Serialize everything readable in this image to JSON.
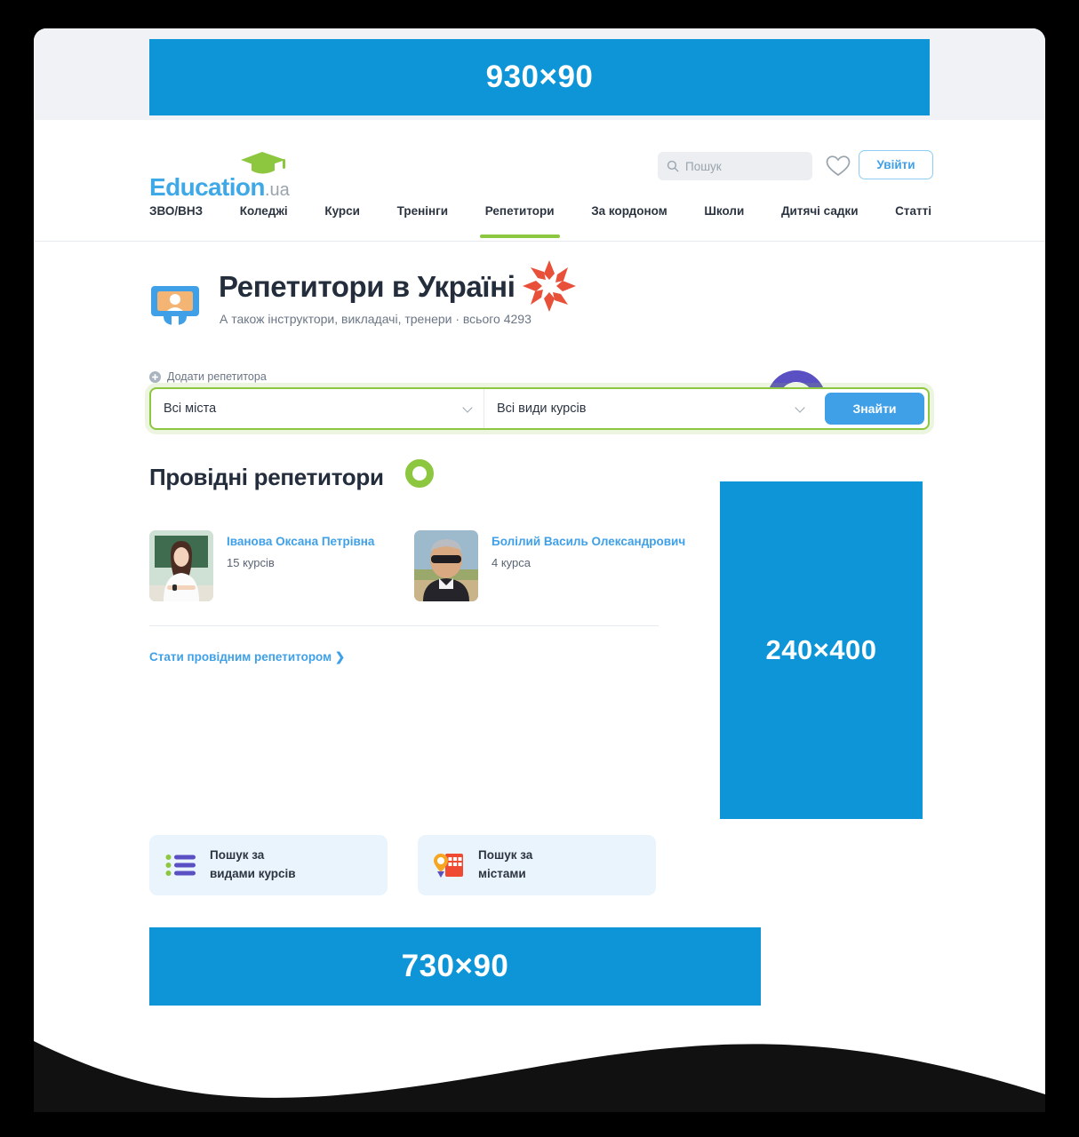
{
  "ads": {
    "top": {
      "label": "930×90"
    },
    "side": {
      "label": "240×400"
    },
    "bottom": {
      "label": "730×90"
    },
    "color": "#0d95d8"
  },
  "header": {
    "logo": {
      "name": "Education",
      "suffix": ".ua"
    },
    "search": {
      "placeholder": "Пошук",
      "value": ""
    },
    "login_label": "Увійти"
  },
  "nav": {
    "items": [
      {
        "label": "ЗВО/ВНЗ",
        "active": false
      },
      {
        "label": "Коледжі",
        "active": false
      },
      {
        "label": "Курси",
        "active": false
      },
      {
        "label": "Тренінги",
        "active": false
      },
      {
        "label": "Репетитори",
        "active": true
      },
      {
        "label": "За кордоном",
        "active": false
      },
      {
        "label": "Школи",
        "active": false
      },
      {
        "label": "Дитячі садки",
        "active": false
      },
      {
        "label": "Статті",
        "active": false
      }
    ],
    "active_color": "#8dc63f"
  },
  "page": {
    "title": "Репетитори в Україні",
    "subtitle": "А також інструктори, викладачі, тренери · всього 4293",
    "add_link": "Додати репетитора"
  },
  "filter": {
    "city": {
      "value": "Всі міста"
    },
    "kind": {
      "value": "Всі види курсів"
    },
    "submit_label": "Знайти",
    "accent": "#8dc63f",
    "button_color": "#3fa0e8"
  },
  "leading": {
    "section_title": "Провідні репетитори",
    "tutors": [
      {
        "name": "Іванова Оксана Петрівна",
        "courses": "15 курсів"
      },
      {
        "name": "Болілий Василь Олександрович",
        "courses": "4 курса"
      }
    ],
    "become_link": "Стати провідним репетитором ❯"
  },
  "cards": [
    {
      "line1": "Пошук за",
      "line2": "видами курсів",
      "icon": "list-icon"
    },
    {
      "line1": "Пошук за",
      "line2": "містами",
      "icon": "map-building-icon"
    }
  ]
}
